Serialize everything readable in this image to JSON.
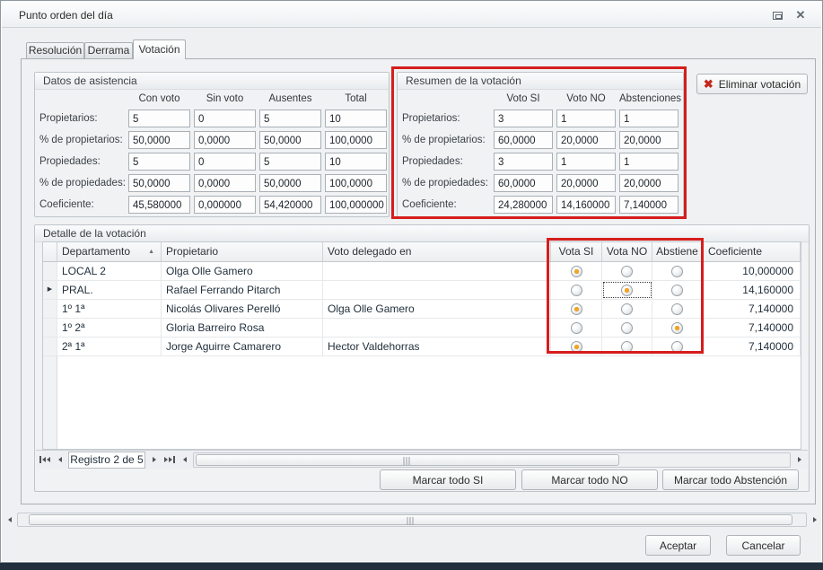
{
  "window": {
    "title": "Punto orden del día"
  },
  "tabs": {
    "resolucion": "Resolución",
    "derrama": "Derrama",
    "votacion": "Votación"
  },
  "attendance": {
    "title": "Datos de asistencia",
    "columns": [
      "Con voto",
      "Sin voto",
      "Ausentes",
      "Total"
    ],
    "rows": [
      {
        "label": "Propietarios:",
        "values": [
          "5",
          "0",
          "5",
          "10"
        ]
      },
      {
        "label": "% de propietarios:",
        "values": [
          "50,0000",
          "0,0000",
          "50,0000",
          "100,0000"
        ]
      },
      {
        "label": "Propiedades:",
        "values": [
          "5",
          "0",
          "5",
          "10"
        ]
      },
      {
        "label": "% de propiedades:",
        "values": [
          "50,0000",
          "0,0000",
          "50,0000",
          "100,0000"
        ]
      },
      {
        "label": "Coeficiente:",
        "values": [
          "45,580000",
          "0,000000",
          "54,420000",
          "100,000000"
        ]
      }
    ]
  },
  "summary": {
    "title": "Resumen de la votación",
    "columns": [
      "Voto SI",
      "Voto NO",
      "Abstenciones"
    ],
    "rows": [
      {
        "label": "Propietarios:",
        "values": [
          "3",
          "1",
          "1"
        ]
      },
      {
        "label": "% de propietarios:",
        "values": [
          "60,0000",
          "20,0000",
          "20,0000"
        ]
      },
      {
        "label": "Propiedades:",
        "values": [
          "3",
          "1",
          "1"
        ]
      },
      {
        "label": "% de propiedades:",
        "values": [
          "60,0000",
          "20,0000",
          "20,0000"
        ]
      },
      {
        "label": "Coeficiente:",
        "values": [
          "24,280000",
          "14,160000",
          "7,140000"
        ]
      }
    ]
  },
  "detail": {
    "title": "Detalle de la votación",
    "columns": {
      "departamento": "Departamento",
      "propietario": "Propietario",
      "delegado": "Voto delegado en",
      "vota_si": "Vota SI",
      "vota_no": "Vota NO",
      "abstiene": "Abstiene",
      "coeficiente": "Coeficiente"
    },
    "rows": [
      {
        "departamento": "LOCAL 2",
        "propietario": "Olga Olle Gamero",
        "delegado": "",
        "vote": "si",
        "coeficiente": "10,000000"
      },
      {
        "departamento": "PRAL.",
        "propietario": "Rafael Ferrando Pitarch",
        "delegado": "",
        "vote": "no",
        "coeficiente": "14,160000"
      },
      {
        "departamento": "1º 1ª",
        "propietario": "Nicolás Olivares Perelló",
        "delegado": "Olga Olle Gamero",
        "vote": "si",
        "coeficiente": "7,140000"
      },
      {
        "departamento": "1º 2ª",
        "propietario": "Gloria Barreiro Rosa",
        "delegado": "",
        "vote": "abstiene",
        "coeficiente": "7,140000"
      },
      {
        "departamento": "2ª 1ª",
        "propietario": "Jorge Aguirre Camarero",
        "delegado": "Hector Valdehorras",
        "vote": "si",
        "coeficiente": "7,140000"
      }
    ],
    "navigator_label": "Registro 2 de 5"
  },
  "buttons": {
    "delete": "Eliminar votación",
    "mark_si": "Marcar todo SI",
    "mark_no": "Marcar todo NO",
    "mark_abst": "Marcar todo Abstención",
    "accept": "Aceptar",
    "cancel": "Cancelar"
  },
  "icons": {
    "delete_x": "✖",
    "sort_asc": "▲",
    "current_row": "▶",
    "close": "✕"
  },
  "colors": {
    "highlight_red": "#d61d1d",
    "radio_selected": "#f7a61b",
    "delete_red": "#c3261d"
  }
}
